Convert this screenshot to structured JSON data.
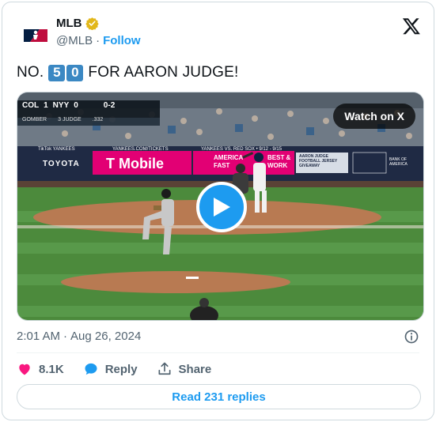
{
  "author": {
    "display_name": "MLB",
    "handle": "@MLB",
    "separator": "·",
    "follow_label": "Follow",
    "verified": true
  },
  "tweet": {
    "text_before": "NO.",
    "digits": [
      "5",
      "0"
    ],
    "text_after": "FOR AARON JUDGE!"
  },
  "media": {
    "watch_label": "Watch on X",
    "scoreboard": {
      "away_team": "COL",
      "away_score": "1",
      "home_team": "NYY",
      "home_score": "0",
      "count": "0-2",
      "pitcher": "GOMBER",
      "batter": "3 JUDGE",
      "batter_avg": ".332"
    },
    "signs": {
      "top_left_banner": "TikTok  YANKEES",
      "tickets": "YANKEES.COM/TICKETS",
      "promo": "YANKEES VS. RED SOX • 9/12 - 9/15",
      "toyota": "TOYOTA",
      "tmobile": "T Mobile",
      "amex_line1": "AMERICA",
      "amex_line2": "FAST",
      "best_line1": "BEST &",
      "best_line2": "WORK",
      "judge_sign": "AARON JUDGE FOOTBALL JERSEY GIVEAWAY",
      "bank_line1": "BANK OF",
      "bank_line2": "AMERICA"
    }
  },
  "timestamp": {
    "time": "2:01 AM",
    "separator": "·",
    "date": "Aug 26, 2024"
  },
  "actions": {
    "likes": "8.1K",
    "reply_label": "Reply",
    "share_label": "Share"
  },
  "replies_button": "Read 231 replies",
  "colors": {
    "accent": "#1d9bf0",
    "like": "#f91880",
    "verified": "#e2b719",
    "keycap": "#3b88c3"
  }
}
